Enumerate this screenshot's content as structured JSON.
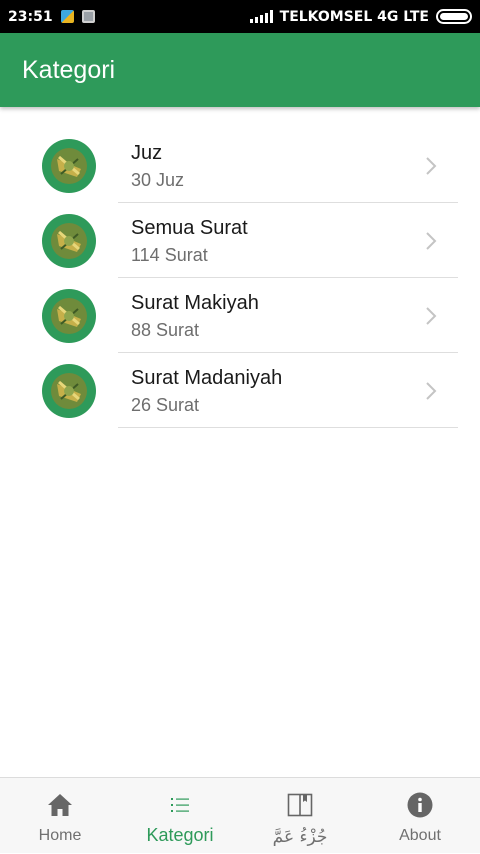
{
  "status_bar": {
    "time": "23:51",
    "carrier": "TELKOMSEL 4G LTE"
  },
  "app_bar": {
    "title": "Kategori"
  },
  "categories": [
    {
      "title": "Juz",
      "subtitle": "30 Juz"
    },
    {
      "title": "Semua Surat",
      "subtitle": "114 Surat"
    },
    {
      "title": "Surat Makiyah",
      "subtitle": "88 Surat"
    },
    {
      "title": "Surat Madaniyah",
      "subtitle": "26 Surat"
    }
  ],
  "bottom_nav": {
    "items": [
      {
        "label": "Home",
        "icon": "home-icon"
      },
      {
        "label": "Kategori",
        "icon": "list-icon",
        "active": true
      },
      {
        "label": "جُزْءُ عَمَّ",
        "icon": "book-icon"
      },
      {
        "label": "About",
        "icon": "info-icon"
      }
    ]
  },
  "colors": {
    "primary": "#2e9a5a",
    "active_tab": "#2e9a5a",
    "inactive_tab": "#707070"
  }
}
